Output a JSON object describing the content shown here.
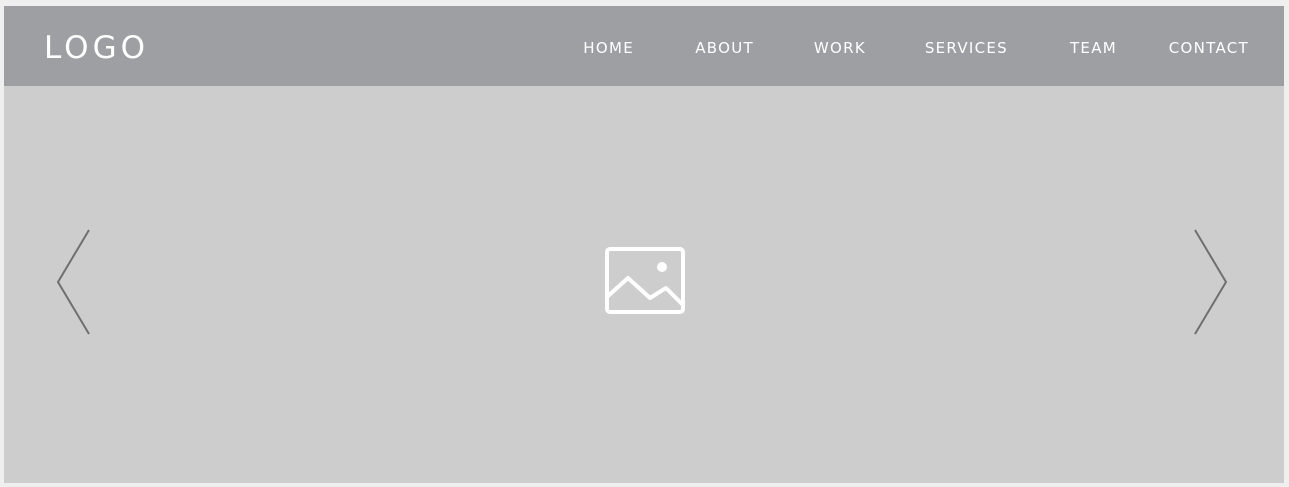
{
  "header": {
    "logo": "LOGO",
    "nav": [
      {
        "label": "HOME"
      },
      {
        "label": "ABOUT"
      },
      {
        "label": "WORK"
      },
      {
        "label": "SERVICES"
      },
      {
        "label": "TEAM"
      },
      {
        "label": "CONTACT"
      }
    ]
  },
  "hero": {
    "image_icon": "image-placeholder-icon",
    "prev_icon": "chevron-left-icon",
    "next_icon": "chevron-right-icon"
  },
  "colors": {
    "header_bg": "#9d9fa2",
    "hero_bg": "#cdcdcd",
    "nav_text": "#ffffff",
    "arrow_stroke": "#6f6f6f",
    "icon_stroke": "#ffffff"
  }
}
